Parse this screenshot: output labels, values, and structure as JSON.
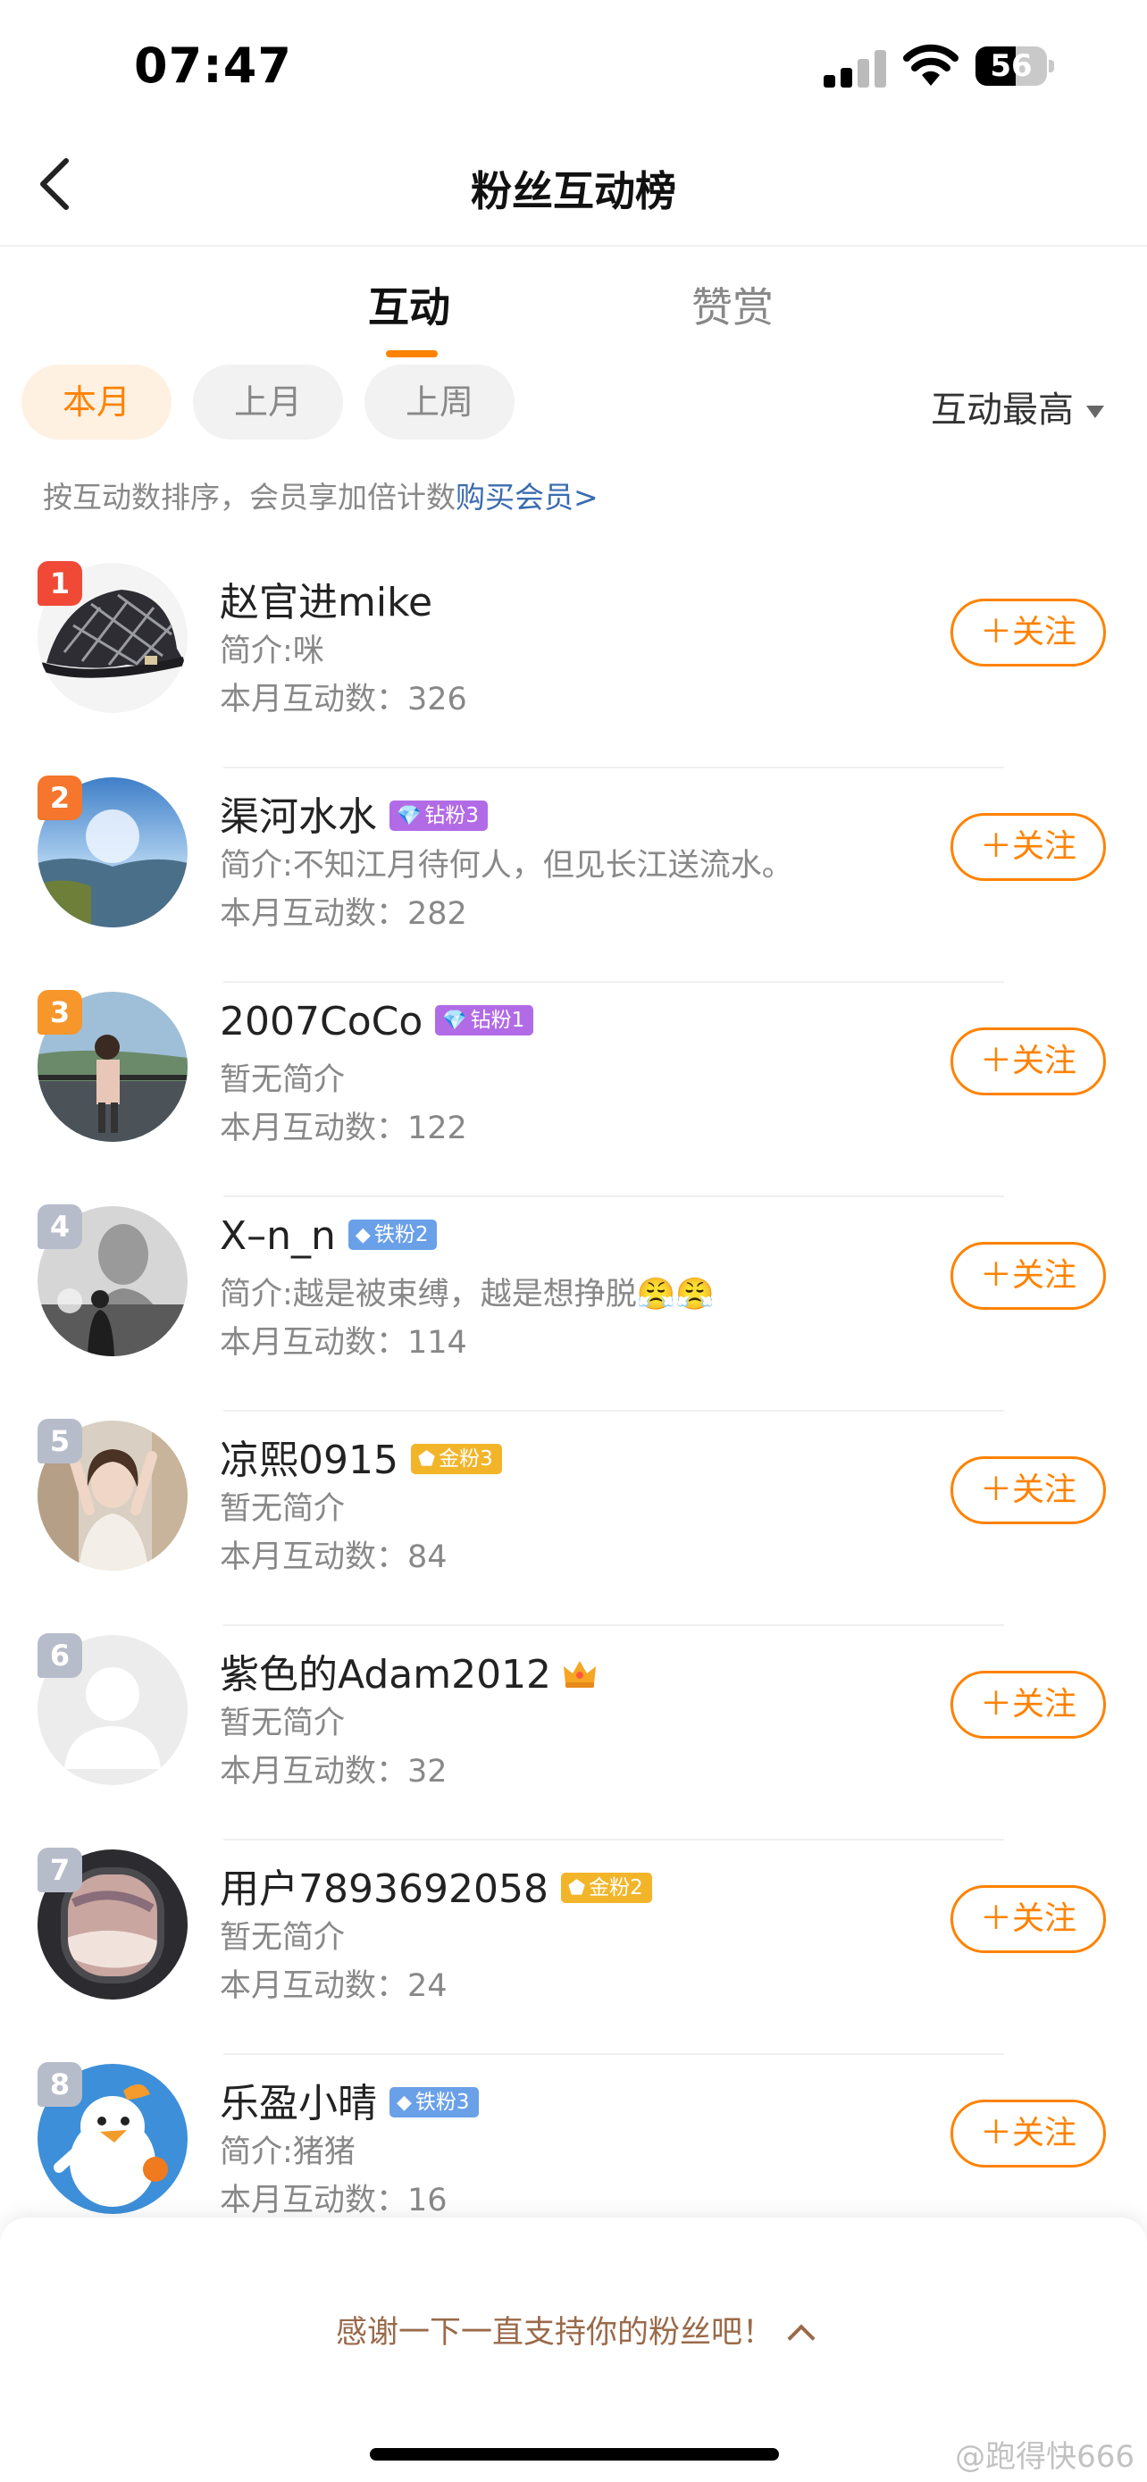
{
  "status_bar": {
    "time": "07:47",
    "battery": "56",
    "battery_level": 0.56
  },
  "header": {
    "title": "粉丝互动榜"
  },
  "tabs": [
    {
      "label": "互动",
      "active": true
    },
    {
      "label": "赞赏",
      "active": false
    }
  ],
  "filters": [
    {
      "label": "本月",
      "active": true
    },
    {
      "label": "上月",
      "active": false
    },
    {
      "label": "上周",
      "active": false
    }
  ],
  "sort": {
    "label": "互动最高"
  },
  "hint": {
    "text": "按互动数排序，会员享加倍计数",
    "link": "购买会员>"
  },
  "colors": {
    "accent": "#ff8200",
    "link": "#3a6bb0",
    "rank_1": "#f04a37",
    "rank_2": "#f5762c",
    "rank_3": "#f7962a",
    "rank_other": "#b7bccb",
    "badge_diamond": "#b26be6",
    "badge_iron": "#6aa0e8",
    "badge_gold": "#f2b52a"
  },
  "fans": [
    {
      "rank": "1",
      "name": "赵官进mike",
      "badge": "",
      "intro": "简介:咪",
      "count": "本月互动数：326",
      "follow": "＋关注"
    },
    {
      "rank": "2",
      "name": "渠河水水",
      "badge": "钻粉3",
      "badge_type": "diamond",
      "intro": "简介:不知江月待何人，但见长江送流水。",
      "count": "本月互动数：282",
      "follow": "＋关注"
    },
    {
      "rank": "3",
      "name": "2007CoCo",
      "badge": "钻粉1",
      "badge_type": "diamond",
      "intro": "暂无简介",
      "count": "本月互动数：122",
      "follow": "＋关注"
    },
    {
      "rank": "4",
      "name": "X–n_n",
      "badge": "铁粉2",
      "badge_type": "iron",
      "intro": "简介:越是被束缚，越是想挣脱😤😤",
      "count": "本月互动数：114",
      "follow": "＋关注"
    },
    {
      "rank": "5",
      "name": "凉熙0915",
      "badge": "金粉3",
      "badge_type": "gold",
      "intro": "暂无简介",
      "count": "本月互动数：84",
      "follow": "＋关注"
    },
    {
      "rank": "6",
      "name": "紫色的Adam2012",
      "badge": "",
      "crown": true,
      "intro": "暂无简介",
      "count": "本月互动数：32",
      "follow": "＋关注"
    },
    {
      "rank": "7",
      "name": "用户7893692058",
      "badge": "金粉2",
      "badge_type": "gold",
      "intro": "暂无简介",
      "count": "本月互动数：24",
      "follow": "＋关注"
    },
    {
      "rank": "8",
      "name": "乐盈小晴",
      "badge": "铁粉3",
      "badge_type": "iron",
      "intro": "简介:猪猪",
      "count": "本月互动数：16",
      "follow": "＋关注"
    }
  ],
  "footer": {
    "thanks": "感谢一下一直支持你的粉丝吧！",
    "watermark": "@跑得快666"
  }
}
